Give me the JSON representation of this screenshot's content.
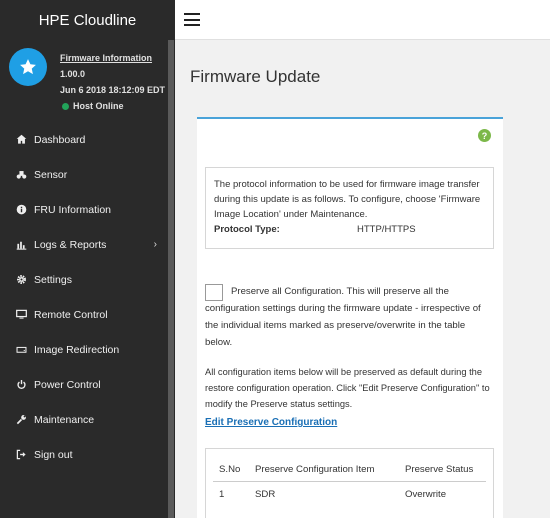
{
  "brand": "HPE Cloudline",
  "user": {
    "link": "Firmware Information",
    "version": "1.00.0",
    "datetime": "Jun 6 2018 18:12:09 EDT",
    "status": "Host Online"
  },
  "menu": [
    {
      "label": "Dashboard",
      "icon": "dashboard-icon"
    },
    {
      "label": "Sensor",
      "icon": "sensor-icon"
    },
    {
      "label": "FRU Information",
      "icon": "info-icon"
    },
    {
      "label": "Logs & Reports",
      "icon": "bar-chart-icon",
      "has_children": true
    },
    {
      "label": "Settings",
      "icon": "gear-icon"
    },
    {
      "label": "Remote Control",
      "icon": "monitor-icon"
    },
    {
      "label": "Image Redirection",
      "icon": "drive-icon"
    },
    {
      "label": "Power Control",
      "icon": "power-icon"
    },
    {
      "label": "Maintenance",
      "icon": "wrench-icon"
    },
    {
      "label": "Sign out",
      "icon": "sign-out-icon"
    }
  ],
  "page_title": "Firmware Update",
  "info": {
    "text": "The protocol information to be used for firmware image transfer during this update is as follows. To configure, choose 'Firmware Image Location' under Maintenance.",
    "protocol_label": "Protocol Type:",
    "protocol_value": "HTTP/HTTPS"
  },
  "preserve": {
    "line1": "Preserve all Configuration. This will preserve all the",
    "rest": "configuration settings during the firmware update - irrespective of the individual items marked as preserve/overwrite in the table below."
  },
  "description": "All configuration items below will be preserved as default during the restore configuration operation. Click \"Edit Preserve Configuration\" to modify the Preserve status settings.",
  "edit_link": "Edit Preserve Configuration",
  "table": {
    "headers": [
      "S.No",
      "Preserve Configuration Item",
      "Preserve Status"
    ],
    "rows": [
      [
        "1",
        "SDR",
        "Overwrite"
      ]
    ]
  },
  "colors": {
    "sidebar": "#2a2a2a",
    "accent": "#4aa3d9",
    "avatar": "#1f9fe5",
    "online": "#22a35a",
    "help": "#7cb84a",
    "link": "#1a6fb5"
  }
}
